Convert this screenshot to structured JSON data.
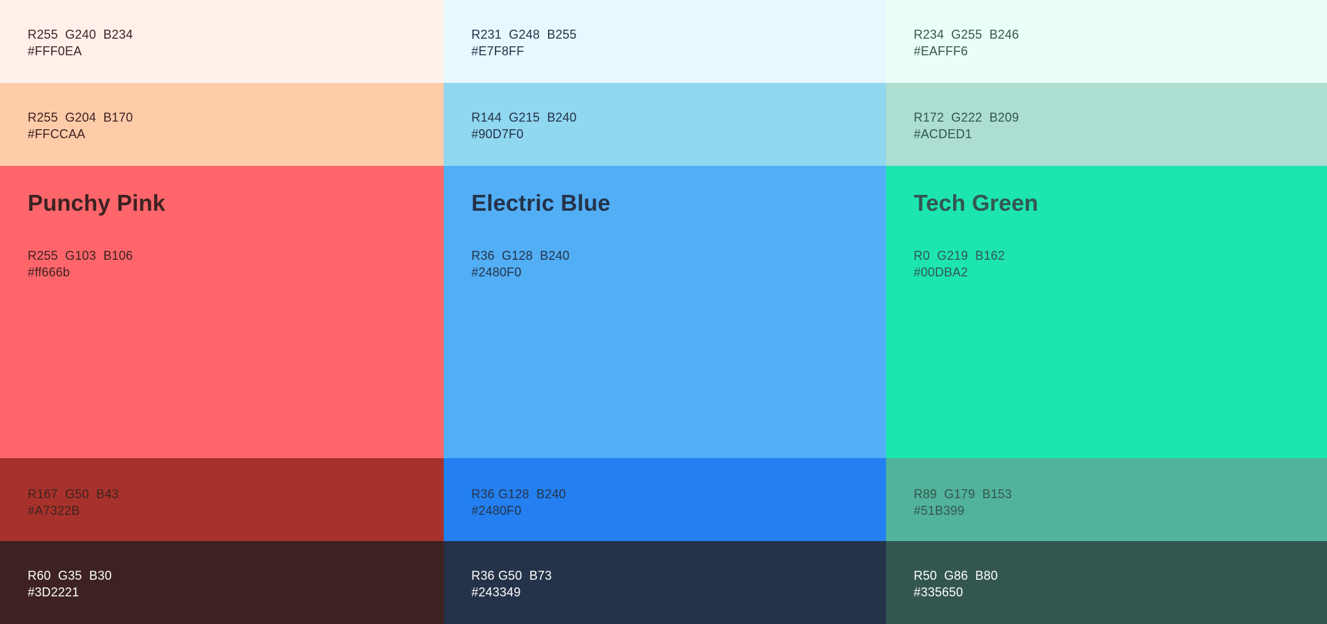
{
  "palettes": [
    {
      "name": "Punchy Pink",
      "swatches": {
        "tint1": {
          "rgb": "R255  G240  B234",
          "hex": "#FFF0EA",
          "bg": "#FFF0EA",
          "fg": "#3D2221"
        },
        "tint2": {
          "rgb": "R255  G204  B170",
          "hex": "#FFCCAA",
          "bg": "#FFCCAA",
          "fg": "#3D2221"
        },
        "main": {
          "rgb": "R255  G103  B106",
          "hex": "#ff666b",
          "bg": "#FF666B",
          "fg": "#3D2221"
        },
        "shade1": {
          "rgb": "R167  G50  B43",
          "hex": "#A7322B",
          "bg": "#A7322B",
          "fg": "#3D2221"
        },
        "shade2": {
          "rgb": "R60  G35  B30",
          "hex": "#3D2221",
          "bg": "#3D2221",
          "fg": "#FFFFFF"
        }
      }
    },
    {
      "name": "Electric Blue",
      "swatches": {
        "tint1": {
          "rgb": "R231  G248  B255",
          "hex": "#E7F8FF",
          "bg": "#E7F8FF",
          "fg": "#243349"
        },
        "tint2": {
          "rgb": "R144  G215  B240",
          "hex": "#90D7F0",
          "bg": "#90D7F0",
          "fg": "#243349"
        },
        "main": {
          "rgb": "R36  G128  B240",
          "hex": "#2480F0",
          "bg": "#52AEF5",
          "fg": "#243349"
        },
        "shade1": {
          "rgb": "R36 G128  B240",
          "hex": "#2480F0",
          "bg": "#2480F0",
          "fg": "#243349"
        },
        "shade2": {
          "rgb": "R36 G50  B73",
          "hex": "#243349",
          "bg": "#243349",
          "fg": "#FFFFFF"
        }
      }
    },
    {
      "name": "Tech Green",
      "swatches": {
        "tint1": {
          "rgb": "R234  G255  B246",
          "hex": "#EAFFF6",
          "bg": "#EAFFF6",
          "fg": "#335650"
        },
        "tint2": {
          "rgb": "R172  G222  B209",
          "hex": "#ACDED1",
          "bg": "#ACDED1",
          "fg": "#335650"
        },
        "main": {
          "rgb": "R0  G219  B162",
          "hex": "#00DBA2",
          "bg": "#1DE5B0",
          "fg": "#335650"
        },
        "shade1": {
          "rgb": "R89  G179  B153",
          "hex": "#51B399",
          "bg": "#51B399",
          "fg": "#335650"
        },
        "shade2": {
          "rgb": "R50  G86  B80",
          "hex": "#335650",
          "bg": "#335650",
          "fg": "#FFFFFF"
        }
      }
    }
  ]
}
